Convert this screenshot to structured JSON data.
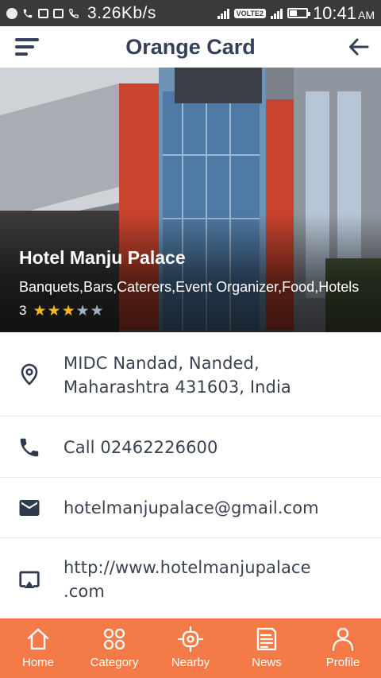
{
  "status_bar": {
    "speed": "3.26Kb/s",
    "network_tag": "VOLTE2",
    "time": "10:41",
    "ampm": "AM"
  },
  "header": {
    "title": "Orange Card"
  },
  "hotel": {
    "name": "Hotel Manju Palace",
    "categories": "Banquets,Bars,Caterers,Event Organizer,Food,Hotels",
    "rating_value": "3",
    "rating": 3,
    "rating_max": 5,
    "star_on_color": "#f5b81b",
    "star_off_color": "#9fb0c4"
  },
  "details": {
    "address_line1": "MIDC Nandad, Nanded,",
    "address_line2": "Maharashtra 431603, India",
    "call": "Call 02462226600",
    "email": "hotelmanjupalace@gmail.com",
    "website_line1": "http://www.hotelmanjupalace",
    "website_line2": ".com"
  },
  "icons": {
    "address": "location-pin-icon",
    "call": "phone-icon",
    "email": "mail-icon",
    "website": "screen-cast-icon"
  },
  "nav": {
    "items": [
      {
        "label": "Home",
        "icon": "home-icon"
      },
      {
        "label": "Category",
        "icon": "category-icon"
      },
      {
        "label": "Nearby",
        "icon": "nearby-icon"
      },
      {
        "label": "News",
        "icon": "news-icon"
      },
      {
        "label": "Profile",
        "icon": "profile-icon"
      }
    ]
  },
  "colors": {
    "accent": "#f47b47",
    "header_text": "#34405a",
    "status_bar": "#3a3a3a"
  }
}
